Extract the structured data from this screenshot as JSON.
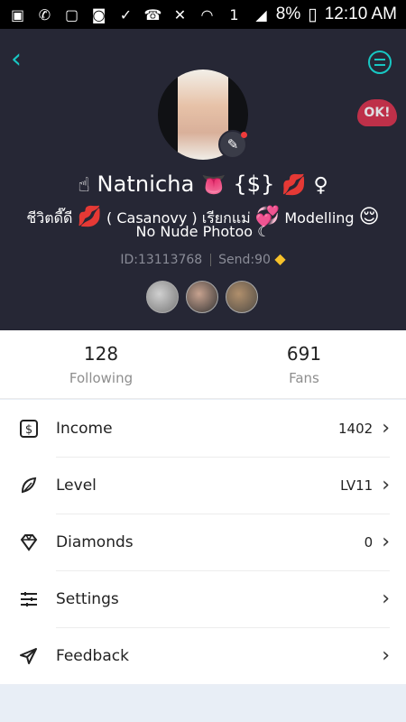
{
  "status": {
    "battery": "8%",
    "time": "12:10 AM",
    "sim": "1",
    "icons": [
      "message-icon",
      "phone-icon",
      "image-icon",
      "app-icon",
      "check-icon",
      "call-icon",
      "mute-icon",
      "wifi-icon",
      "signal-icon",
      "battery-icon"
    ]
  },
  "header": {
    "back_icon": "back-icon",
    "message_icon": "message-icon",
    "badge_text": "OK!"
  },
  "profile": {
    "name": "Natnicha",
    "bio_line1": "ชีวิตดี๊ดี",
    "bio_line1b": "( Casanovy ) เรียกแม่",
    "bio_line1c": "Modelling",
    "bio_line2": "No Nude Photoo",
    "id": "ID:13113768",
    "send": "Send:90"
  },
  "stats": {
    "following_count": "128",
    "following_label": "Following",
    "fans_count": "691",
    "fans_label": "Fans"
  },
  "menu": {
    "income_label": "Income",
    "income_value": "1402",
    "level_label": "Level",
    "level_value": "LV11",
    "diamonds_label": "Diamonds",
    "diamonds_value": "0",
    "settings_label": "Settings",
    "feedback_label": "Feedback"
  }
}
